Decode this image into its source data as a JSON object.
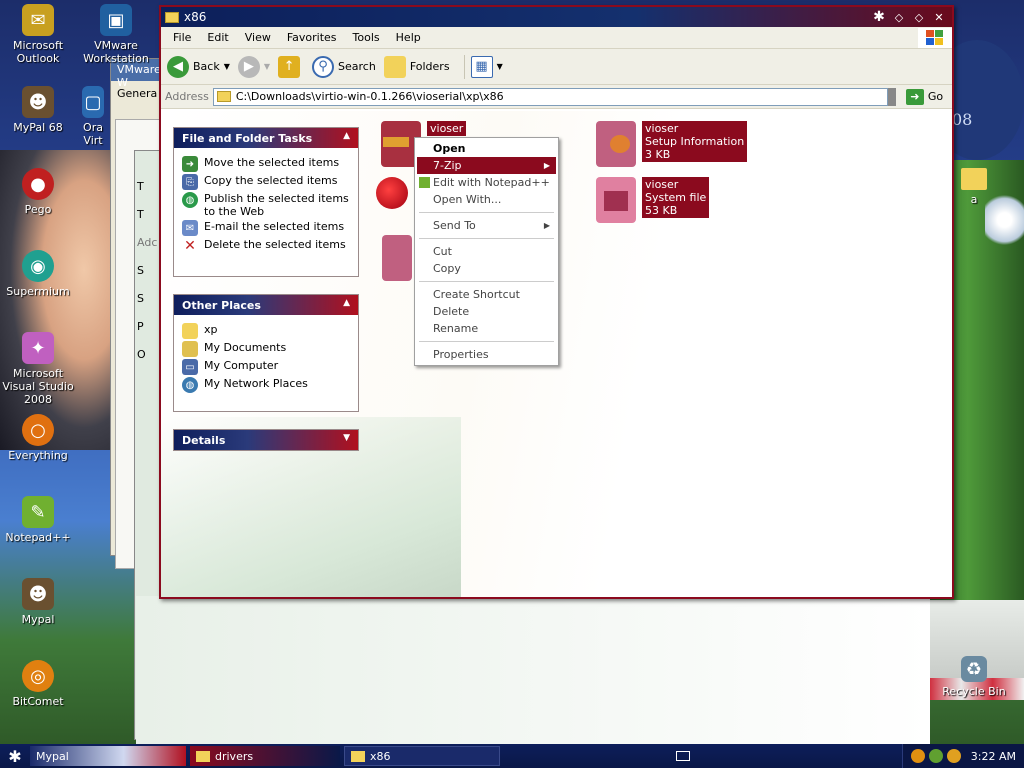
{
  "desktop": {
    "icons": [
      {
        "label": "Microsoft Outlook",
        "color": "#c8a020",
        "glyph": "✉"
      },
      {
        "label": "VMware Workstation",
        "color": "#2060a0",
        "glyph": "▣"
      },
      {
        "label": "MyPal 68",
        "color": "#6a5030",
        "glyph": "☻"
      },
      {
        "label": "Ora Virt",
        "color": "#2a6ab0",
        "glyph": "▢"
      },
      {
        "label": "Pego",
        "color": "#c02020",
        "glyph": "●"
      },
      {
        "label": "Supermium",
        "color": "#20a090",
        "glyph": "◉"
      },
      {
        "label": "Microsoft Visual Studio 2008",
        "color": "#c060c0",
        "glyph": "✦"
      },
      {
        "label": "Everything",
        "color": "#e07010",
        "glyph": "○"
      },
      {
        "label": "Notepad++",
        "color": "#70b030",
        "glyph": "✎"
      },
      {
        "label": "Mypal",
        "color": "#6a5030",
        "glyph": "☻"
      },
      {
        "label": "BitComet",
        "color": "#e08010",
        "glyph": "◎"
      },
      {
        "label": "a",
        "color": "#f2d25a",
        "glyph": ""
      },
      {
        "label": "Recycle Bin",
        "color": "#6a8aa0",
        "glyph": "♻"
      }
    ],
    "bg_window_1_title": "VMware W",
    "bg_window_1_tab": "Genera",
    "bg_window_2_letters": [
      "T",
      "T",
      "Adc",
      "S",
      "S",
      "P",
      "O"
    ]
  },
  "window": {
    "title": "x86",
    "controls": [
      "✱",
      "◇",
      "◇",
      "✕"
    ],
    "menu": [
      "File",
      "Edit",
      "View",
      "Favorites",
      "Tools",
      "Help"
    ],
    "toolbar": {
      "back": "Back",
      "search": "Search",
      "folders": "Folders"
    },
    "address": {
      "label": "Address",
      "value": "C:\\Downloads\\virtio-win-0.1.266\\vioserial\\xp\\x86",
      "go": "Go"
    }
  },
  "panes": {
    "file_tasks": {
      "title": "File and Folder Tasks",
      "items": [
        {
          "label": "Move the selected items",
          "color": "#3a8a3a"
        },
        {
          "label": "Copy the selected items",
          "color": "#4a6aa8"
        },
        {
          "label": "Publish the selected items to the Web",
          "color": "#2a9a4a"
        },
        {
          "label": "E-mail the selected items",
          "color": "#6a8ac8"
        },
        {
          "label": "Delete the selected items",
          "color": "#c02020"
        }
      ]
    },
    "other_places": {
      "title": "Other Places",
      "items": [
        {
          "label": "xp",
          "color": "#f2d25a"
        },
        {
          "label": "My Documents",
          "color": "#e0c050"
        },
        {
          "label": "My Computer",
          "color": "#4a6aa8"
        },
        {
          "label": "My Network Places",
          "color": "#3a7ab0"
        }
      ]
    },
    "details": {
      "title": "Details"
    }
  },
  "files": [
    {
      "name": "vioser",
      "line2": "",
      "line3": "",
      "color": "#a83040"
    },
    {
      "name": "vioser",
      "line2": "Setup Information",
      "line3": "3 KB",
      "color": "#c06080"
    },
    {
      "name": "vioser",
      "line2": "System file",
      "line3": "53 KB",
      "color": "#c06080"
    }
  ],
  "context_menu": {
    "items": [
      {
        "label": "Open",
        "type": "bold"
      },
      {
        "label": "7-Zip",
        "type": "highlight",
        "submenu": true
      },
      {
        "label": "Edit with Notepad++",
        "type": "normal"
      },
      {
        "label": "Open With...",
        "type": "normal"
      },
      {
        "label": "Send To",
        "type": "normal",
        "submenu": true
      },
      {
        "label": "Cut",
        "type": "normal"
      },
      {
        "label": "Copy",
        "type": "normal"
      },
      {
        "label": "Create Shortcut",
        "type": "normal"
      },
      {
        "label": "Delete",
        "type": "normal"
      },
      {
        "label": "Rename",
        "type": "normal"
      },
      {
        "label": "Properties",
        "type": "normal"
      }
    ]
  },
  "taskbar": {
    "items": [
      "Mypal",
      "drivers",
      "x86"
    ],
    "clock": "3:22 AM"
  },
  "colors": {
    "accent": "#8b0a1e",
    "navy": "#0e1e5c"
  }
}
